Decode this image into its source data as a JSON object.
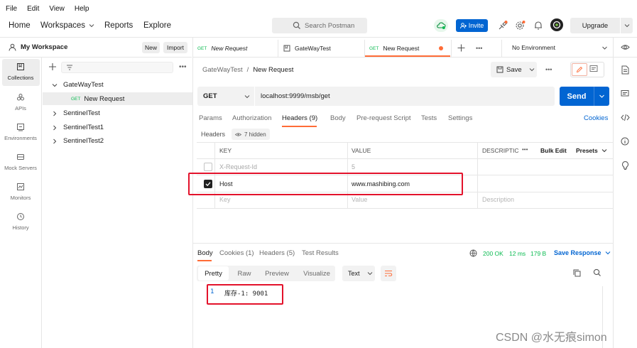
{
  "menu": [
    "File",
    "Edit",
    "View",
    "Help"
  ],
  "nav": {
    "home": "Home",
    "workspaces": "Workspaces",
    "reports": "Reports",
    "explore": "Explore"
  },
  "search_placeholder": "Search Postman",
  "invite": "Invite",
  "upgrade": "Upgrade",
  "workspace": {
    "name": "My Workspace",
    "new": "New",
    "import": "Import"
  },
  "sidebar": [
    {
      "label": "Collections"
    },
    {
      "label": "APIs"
    },
    {
      "label": "Environments"
    },
    {
      "label": "Mock Servers"
    },
    {
      "label": "Monitors"
    },
    {
      "label": "History"
    }
  ],
  "tree": {
    "collections": [
      "GateWayTest",
      "SentinelTest",
      "SentinelTest1",
      "SentinelTest2"
    ],
    "request": {
      "method": "GET",
      "name": "New Request"
    }
  },
  "tabs": [
    {
      "method": "GET",
      "name": "New Request"
    },
    {
      "name": "GateWayTest"
    },
    {
      "method": "GET",
      "name": "New Request"
    }
  ],
  "environment": "No Environment",
  "breadcrumb": {
    "parent": "GateWayTest",
    "sep": "/",
    "current": "New Request"
  },
  "save": "Save",
  "request": {
    "method": "GET",
    "url": "localhost:9999/msb/get",
    "send": "Send"
  },
  "request_tabs": [
    "Params",
    "Authorization",
    "Headers (9)",
    "Body",
    "Pre-request Script",
    "Tests",
    "Settings"
  ],
  "cookies": "Cookies",
  "headers_bar": {
    "label": "Headers",
    "hidden": "7 hidden"
  },
  "table": {
    "cols": [
      "KEY",
      "VALUE",
      "DESCRIPTIC"
    ],
    "bulk_edit": "Bulk Edit",
    "presets": "Presets",
    "rows": [
      {
        "key": "X-Request-Id",
        "value": "5",
        "checked": false
      },
      {
        "key": "Host",
        "value": "www.mashibing.com",
        "checked": true
      }
    ],
    "placeholder": {
      "key": "Key",
      "value": "Value",
      "description": "Description"
    }
  },
  "response": {
    "tabs": [
      "Body",
      "Cookies (1)",
      "Headers (5)",
      "Test Results"
    ],
    "status": "200 OK",
    "time": "12 ms",
    "size": "179 B",
    "save": "Save Response",
    "views": [
      "Pretty",
      "Raw",
      "Preview",
      "Visualize"
    ],
    "format": "Text",
    "line": "1",
    "content": "库存-1: 9001"
  },
  "watermark": "CSDN @水无痕simon",
  "colors": {
    "accent": "#0265d2",
    "orange": "#ff6c37",
    "red": "#e3122b",
    "green": "#0cbb52"
  }
}
